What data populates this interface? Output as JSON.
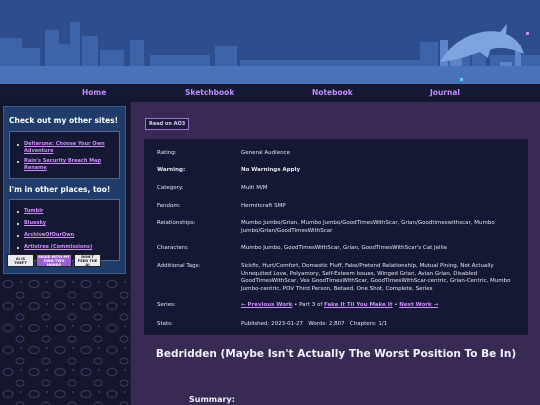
{
  "nav": {
    "items": [
      "Home",
      "Sketchbook",
      "Notebook",
      "Journal"
    ]
  },
  "sidebar": {
    "sites_title": "Check out my other sites!",
    "sites": [
      "Deltarune: Choose Your Own Adventure",
      "Rain's Security Breach Map Rename"
    ],
    "places_title": "I'm in other places, too!",
    "places": [
      "Tumblr",
      "Bluesky",
      "ArchiveOfOurOwn",
      "Artistree (Commissions)"
    ],
    "badges": [
      "AI IS THEFT",
      "MADE WITH MY OWN TWO HANDS",
      "DON'T FEED THE AI"
    ]
  },
  "main": {
    "ao3_button": "Read on AO3",
    "metadata": [
      {
        "key": "Rating:",
        "value": "General Audience"
      },
      {
        "key": "Warning:",
        "value": "No Warnings Apply"
      },
      {
        "key": "Category:",
        "value": "Multi M/M"
      },
      {
        "key": "Fandom:",
        "value": "Hermitcraft SMP"
      },
      {
        "key": "Relationships:",
        "value": "Mumbo Jumbo/Grian, Mumbo Jumbo/GoodTimesWithScar, Grian/Goodtimeswithscar, Mumbo Jumbo/Grian/GoodTimesWithScar"
      },
      {
        "key": "Characters:",
        "value": "Mumbo Jumbo, GoodTimesWithScar, Grian, GoodTimesWithScar's Cat Jellie"
      },
      {
        "key": "Additional Tags:",
        "value": "Sickfic, Hurt/Comfort, Domestic Fluff, Fake/Pretend Relationship, Mutual Pining, Not Actually Unrequited Love, Polyamory, Self-Esteem Issues, Winged Grian, Avian Grian, Disabled GoodTimesWithScar, Vex GoodTimesWithScar, GoodTimesWithScar-centric, Grian-Centric, Mumbo Jumbo-centric, POV Third Person, Betaed, One Shot, Complete, Series"
      },
      {
        "key": "Series:",
        "prev": "← Previous Work",
        "mid": " • Part 3 of ",
        "series_name": "Fake It Til You Make It",
        "sep": " • ",
        "next": "Next Work →"
      },
      {
        "key": "Stats:",
        "published": "Published: 2023-01-27",
        "words": "Words: 2,807",
        "chapters": "Chapters: 1/1"
      }
    ],
    "title": "Bedridden (Maybe Isn't Actually The Worst Position To Be In)",
    "summary_label": "Summary:"
  },
  "colors": {
    "header_bg": "#30508f",
    "nav_bg": "#141833",
    "link": "#d08cff",
    "main_bg": "#392a54",
    "panel_bg": "#141834"
  }
}
